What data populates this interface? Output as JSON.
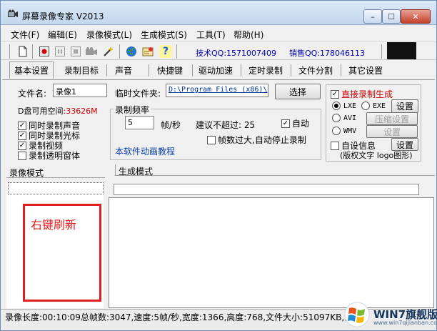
{
  "window": {
    "title": "屏幕录像专家 V2013",
    "buttons": {
      "min": "–",
      "max": "☐",
      "close": "✕"
    }
  },
  "menu": [
    "文件(F)",
    "编辑(E)",
    "录像模式(L)",
    "生成模式(S)",
    "工具(T)",
    "帮助(H)"
  ],
  "toolbar": {
    "icons": [
      "new-file-icon",
      "record-icon",
      "pause-icon",
      "stop-icon",
      "camera-icon",
      "wand-icon",
      "globe-icon",
      "certificate-icon",
      "help-icon"
    ],
    "tech_qq": "技术QQ:1571007409",
    "sales_qq": "销售QQ:178046113"
  },
  "tabs": [
    "基本设置",
    "录制目标",
    "声音",
    "快捷键",
    "驱动加速",
    "定时录制",
    "文件分割",
    "其它设置"
  ],
  "basic": {
    "filename_label": "文件名:",
    "filename_value": "录像1",
    "tempdir_label": "临时文件夹:",
    "tempdir_value": "D:\\Program Files (x86)\\",
    "choose_button": "选择",
    "disk_label": "D盘可用空间",
    "disk_value": ":33626M",
    "checkboxes": [
      {
        "label": "同时录制声音",
        "checked": true
      },
      {
        "label": "同时录制光标",
        "checked": true
      },
      {
        "label": "录制视频",
        "checked": true
      },
      {
        "label": "录制透明窗体",
        "checked": false
      }
    ],
    "freq_group": "录制频率",
    "fps_value": "5",
    "fps_unit": "帧/秒",
    "suggest_label": "建议不超过: 25",
    "auto_label": "自动",
    "auto_checked": true,
    "autostop_label": "帧数过大,自动停止录制",
    "autostop_checked": false,
    "tutorial_link": "本软件动画教程"
  },
  "direct": {
    "label": "直接录制生成",
    "checked": true,
    "formats": [
      {
        "a": "LXE",
        "b": "EXE",
        "selected": true,
        "button": "设置",
        "button_enabled": true
      },
      {
        "a": "AVI",
        "b": "",
        "selected": false,
        "button": "压缩设置",
        "button_enabled": false
      },
      {
        "a": "WMV",
        "b": "",
        "selected": false,
        "button": "设置",
        "button_enabled": false
      }
    ],
    "selfinfo_label": "自设信息",
    "selfinfo_button": "设置",
    "copyright_note": "(版权文字 logo图形)"
  },
  "lower": {
    "record_mode_title": "录像模式",
    "gen_mode_title": "生成模式",
    "annotation": "右键刷新"
  },
  "status": "录像长度:00:10:09总帧数:3047,速度:5帧/秒,宽度:1366,高度:768,文件大小:51097KB,创",
  "watermark": {
    "brand": "WIN7旗舰版",
    "url": "www.win7qijianban.com"
  }
}
